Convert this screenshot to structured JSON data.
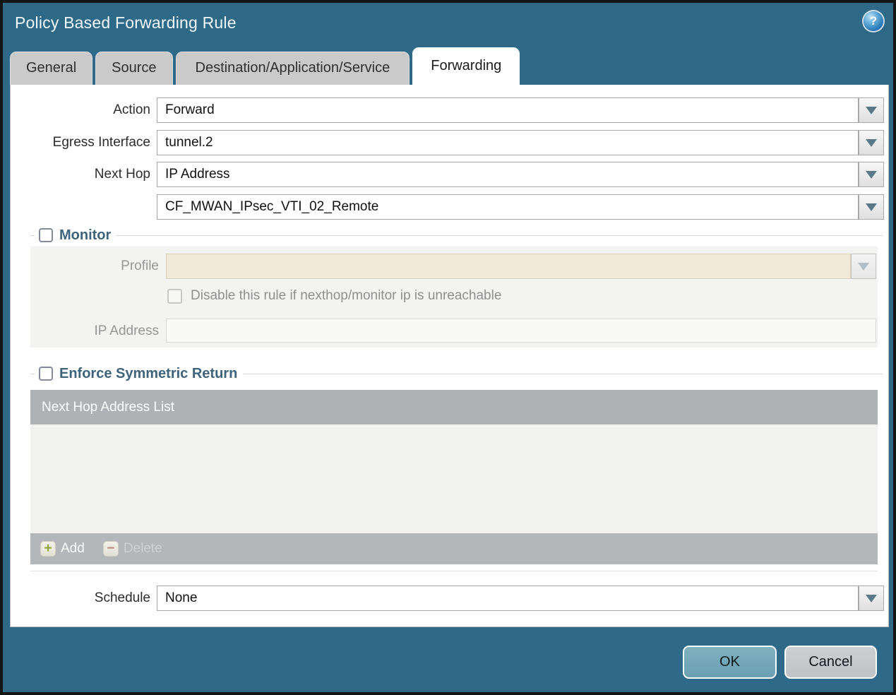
{
  "window": {
    "title": "Policy Based Forwarding Rule",
    "help_glyph": "?"
  },
  "tabs": [
    {
      "label": "General",
      "active": false
    },
    {
      "label": "Source",
      "active": false
    },
    {
      "label": "Destination/Application/Service",
      "active": false
    },
    {
      "label": "Forwarding",
      "active": true
    }
  ],
  "form": {
    "action": {
      "label": "Action",
      "value": "Forward"
    },
    "egress_interface": {
      "label": "Egress Interface",
      "value": "tunnel.2"
    },
    "next_hop": {
      "label": "Next Hop",
      "value": "IP Address"
    },
    "next_hop_target": {
      "value": "CF_MWAN_IPsec_VTI_02_Remote"
    },
    "schedule": {
      "label": "Schedule",
      "value": "None"
    }
  },
  "monitor": {
    "legend": "Monitor",
    "checked": false,
    "profile": {
      "label": "Profile",
      "value": ""
    },
    "disable_rule_checkbox": {
      "label": "Disable this rule if nexthop/monitor ip is unreachable",
      "checked": false
    },
    "ip_address": {
      "label": "IP Address",
      "value": ""
    }
  },
  "symmetric_return": {
    "legend": "Enforce Symmetric Return",
    "checked": false,
    "table": {
      "header": "Next Hop Address List",
      "rows": []
    },
    "toolbar": {
      "add_label": "Add",
      "add_glyph": "+",
      "delete_label": "Delete",
      "delete_glyph": "−",
      "delete_enabled": false
    }
  },
  "footer_buttons": {
    "ok": "OK",
    "cancel": "Cancel"
  },
  "colors": {
    "dialog_background": "#2e6a88",
    "titlebar_text": "#f0f7fa",
    "active_tab_background": "#ffffff",
    "inactive_tab_background": "#cacaca",
    "disabled_field_background": "#f1ead7",
    "section_panel_background": "#f3f3f2",
    "table_header_background": "#aeb2b4",
    "ok_button_background": "#73a7b8",
    "cancel_button_background": "#c6c9cb",
    "add_icon_color": "#8fa637",
    "delete_icon_color": "#b5897f"
  }
}
